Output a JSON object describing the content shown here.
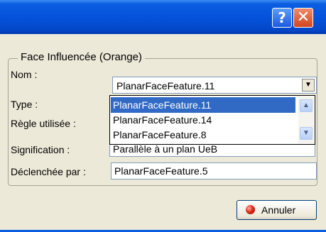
{
  "titlebar": {
    "help_label": "?",
    "close_label": "✕"
  },
  "group": {
    "title": "Face Influencée (Orange)"
  },
  "labels": {
    "nom": "Nom :",
    "type": "Type :",
    "regle": "Règle utilisée :",
    "signification": "Signification :",
    "declenchee": "Déclenchée par :"
  },
  "nom_combo": {
    "value": "PlanarFaceFeature.11",
    "options": [
      "PlanarFaceFeature.11",
      "PlanarFaceFeature.14",
      "PlanarFaceFeature.8"
    ],
    "selected_index": 0
  },
  "signification_value": "Parallèle à un plan UeB",
  "declenchee_value": "PlanarFaceFeature.5",
  "buttons": {
    "cancel_label": "Annuler"
  },
  "icons": {
    "scroll_up": "▲",
    "scroll_down": "▼",
    "dropdown": "▼"
  },
  "colors": {
    "titlebar": "#0553db",
    "selection": "#316ac5",
    "dialog_bg": "#ece9d8"
  }
}
